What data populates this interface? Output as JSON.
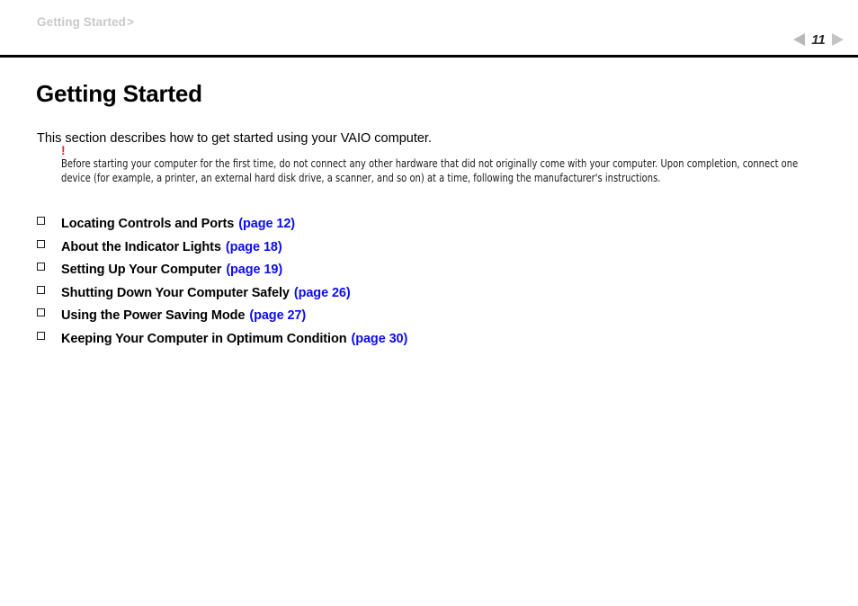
{
  "header": {
    "breadcrumb_label": "Getting Started",
    "breadcrumb_separator": ">",
    "prev_icon": "triangle-left-icon",
    "next_icon": "triangle-right-icon",
    "page_number": "11"
  },
  "main": {
    "title": "Getting Started",
    "intro": "This section describes how to get started using your VAIO computer.",
    "note": {
      "icon": "!",
      "icon_color": "#e8262b",
      "text": "Before starting your computer for the first time, do not connect any other hardware that did not originally come with your computer. Upon completion, connect one device (for example, a printer, an external hard disk drive, a scanner, and so on) at a time, following the manufacturer's instructions."
    },
    "links": [
      {
        "label": "Locating Controls and Ports",
        "page_ref": "(page 12)"
      },
      {
        "label": "About the Indicator Lights",
        "page_ref": "(page 18)"
      },
      {
        "label": "Setting Up Your Computer",
        "page_ref": "(page 19)"
      },
      {
        "label": "Shutting Down Your Computer Safely",
        "page_ref": "(page 26)"
      },
      {
        "label": "Using the Power Saving Mode",
        "page_ref": "(page 27)"
      },
      {
        "label": "Keeping Your Computer in Optimum Condition",
        "page_ref": "(page 30)"
      }
    ]
  },
  "colors": {
    "link": "#0d0df0",
    "breadcrumb": "#c9c9c9",
    "rule": "#000000",
    "nav_arrow": "#bdbdbd"
  }
}
